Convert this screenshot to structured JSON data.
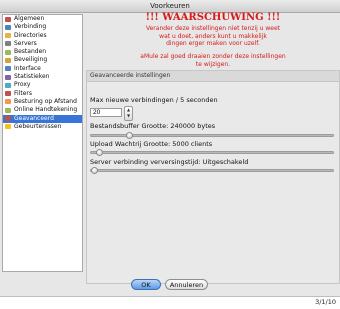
{
  "window": {
    "title": "Voorkeuren"
  },
  "sidebar": {
    "items": [
      {
        "label": "Algemeen",
        "icon": "home-icon",
        "color": "#c0504d"
      },
      {
        "label": "Verbinding",
        "icon": "network-icon",
        "color": "#4f81bd"
      },
      {
        "label": "Directories",
        "icon": "folder-icon",
        "color": "#e3b34a"
      },
      {
        "label": "Servers",
        "icon": "server-icon",
        "color": "#7f7f7f"
      },
      {
        "label": "Bestanden",
        "icon": "file-icon",
        "color": "#9bbb59"
      },
      {
        "label": "Beveiliging",
        "icon": "lock-icon",
        "color": "#d7a23a"
      },
      {
        "label": "Interface",
        "icon": "window-icon",
        "color": "#4f81bd"
      },
      {
        "label": "Statistieken",
        "icon": "chart-icon",
        "color": "#8064a2"
      },
      {
        "label": "Proxy",
        "icon": "proxy-icon",
        "color": "#4bacc6"
      },
      {
        "label": "Filters",
        "icon": "filter-icon",
        "color": "#c0504d"
      },
      {
        "label": "Besturing op Afstand",
        "icon": "remote-icon",
        "color": "#f79646"
      },
      {
        "label": "Online Handtekening",
        "icon": "signature-icon",
        "color": "#9bbb59"
      },
      {
        "label": "Geavanceerd",
        "icon": "advanced-icon",
        "color": "#c0504d",
        "selected": true
      },
      {
        "label": "Gebeurtenissen",
        "icon": "events-icon",
        "color": "#f0c419"
      }
    ]
  },
  "warning": {
    "title": "!!! WAARSCHUWING !!!",
    "line1": "Verander deze instellingen niet tenzij u weet",
    "line2": "wat u doet, anders kunt u makkelijk",
    "line3": "dingen erger maken voor uzelf.",
    "line4": "aMule zal goed draaien zonder deze instellingen",
    "line5": "te wijzigen.",
    "color": "#d61a1a"
  },
  "advanced": {
    "group_title": "Geavanceerde instellingen",
    "max_connections_label": "Max nieuwe verbindingen / 5 seconden",
    "max_connections_value": "20",
    "file_buffer_label": "Bestandsbuffer Grootte: 240000 bytes",
    "file_buffer_level": 0.15,
    "upload_queue_label": "Upload Wachtrij Grootte: 5000 clients",
    "upload_queue_level": 0.02,
    "server_refresh_label": "Server verbinding verversingstijd: Uitgeschakeld",
    "server_refresh_level": 0.0
  },
  "buttons": {
    "ok": "OK",
    "cancel": "Annuleren"
  },
  "footer": {
    "date": "3/1/10"
  }
}
